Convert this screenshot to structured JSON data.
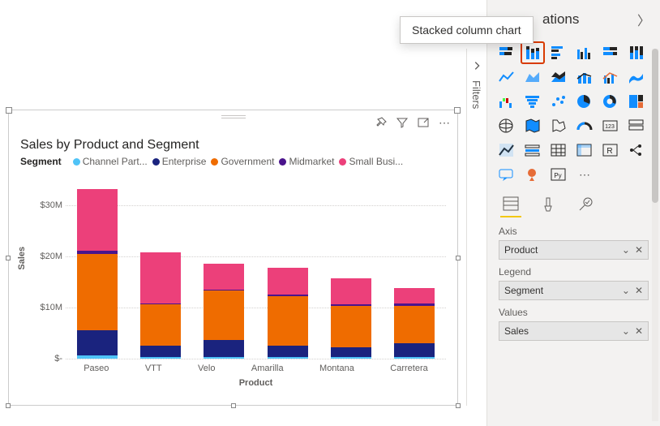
{
  "tooltip": "Stacked column chart",
  "pane_title": "Visualizations",
  "filters_label": "Filters",
  "chart": {
    "title": "Sales by Product and Segment",
    "legend_title": "Segment",
    "legend_items": [
      "Channel Part...",
      "Enterprise",
      "Government",
      "Midmarket",
      "Small Busi..."
    ],
    "xlabel": "Product",
    "ylabel": "Sales",
    "y_ticks": [
      "$30M",
      "$20M",
      "$10M",
      "$-"
    ],
    "categories": [
      "Paseo",
      "VTT",
      "Velo",
      "Amarilla",
      "Montana",
      "Carretera"
    ]
  },
  "fields": {
    "axis_label": "Axis",
    "axis_value": "Product",
    "legend_label": "Legend",
    "legend_value": "Segment",
    "values_label": "Values",
    "values_value": "Sales"
  },
  "colors": {
    "channel": "#4fc3f7",
    "enterprise": "#1a237e",
    "government": "#ef6c00",
    "midmarket": "#4a148c",
    "small": "#ec407a"
  },
  "chart_data": {
    "type": "bar",
    "stacked": true,
    "title": "Sales by Product and Segment",
    "xlabel": "Product",
    "ylabel": "Sales",
    "ylim": [
      0,
      35000000
    ],
    "categories": [
      "Paseo",
      "VTT",
      "Velo",
      "Amarilla",
      "Montana",
      "Carretera"
    ],
    "series": [
      {
        "name": "Channel Partners",
        "values": [
          600000,
          300000,
          300000,
          300000,
          300000,
          300000
        ]
      },
      {
        "name": "Enterprise",
        "values": [
          5000000,
          2300000,
          3300000,
          2300000,
          2000000,
          2700000
        ]
      },
      {
        "name": "Government",
        "values": [
          15000000,
          8000000,
          9700000,
          9700000,
          8000000,
          7400000
        ]
      },
      {
        "name": "Midmarket",
        "values": [
          600000,
          300000,
          300000,
          300000,
          400000,
          400000
        ]
      },
      {
        "name": "Small Business",
        "values": [
          12000000,
          10000000,
          5000000,
          5300000,
          5000000,
          3000000
        ]
      }
    ]
  }
}
